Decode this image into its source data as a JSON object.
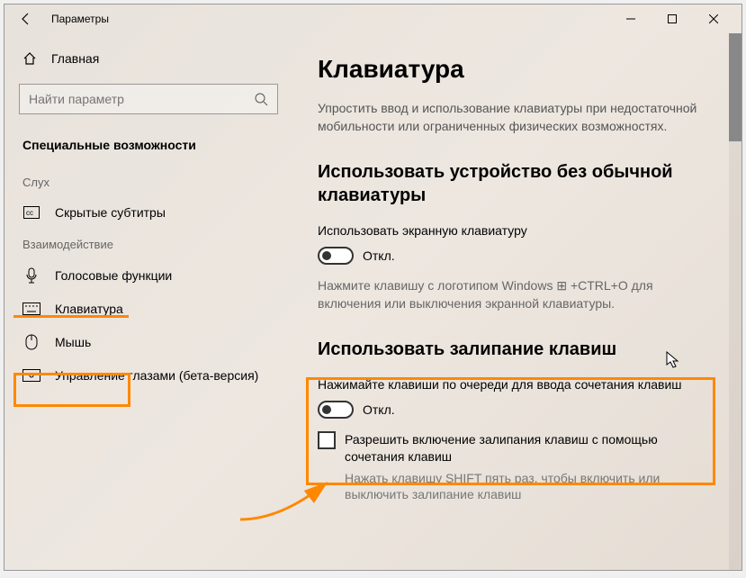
{
  "window": {
    "title": "Параметры"
  },
  "sidebar": {
    "home": "Главная",
    "search_placeholder": "Найти параметр",
    "category": "Специальные возможности",
    "group_hearing": "Слух",
    "group_interaction": "Взаимодействие",
    "items": {
      "subtitles": "Скрытые субтитры",
      "voice": "Голосовые функции",
      "keyboard": "Клавиатура",
      "mouse": "Мышь",
      "eye": "Управление глазами (бета-версия)"
    }
  },
  "main": {
    "h1": "Клавиатура",
    "desc": "Упростить ввод и использование клавиатуры при недостаточной мобильности или ограниченных физических возможностях.",
    "s1_h": "Использовать устройство без обычной клавиатуры",
    "s1_label": "Использовать экранную клавиатуру",
    "toggle_off": "Откл.",
    "s1_help": "Нажмите клавишу с логотипом Windows ⊞  +CTRL+O для включения или выключения экранной клавиатуры.",
    "s2_h": "Использовать залипание клавиш",
    "s2_label": "Нажимайте клавиши по очереди для ввода сочетания клавиш",
    "s2_chk": "Разрешить включение залипания клавиш с помощью сочетания клавиш",
    "s2_help": "Нажать клавишу SHIFT пять раз, чтобы включить или выключить залипание клавиш"
  }
}
